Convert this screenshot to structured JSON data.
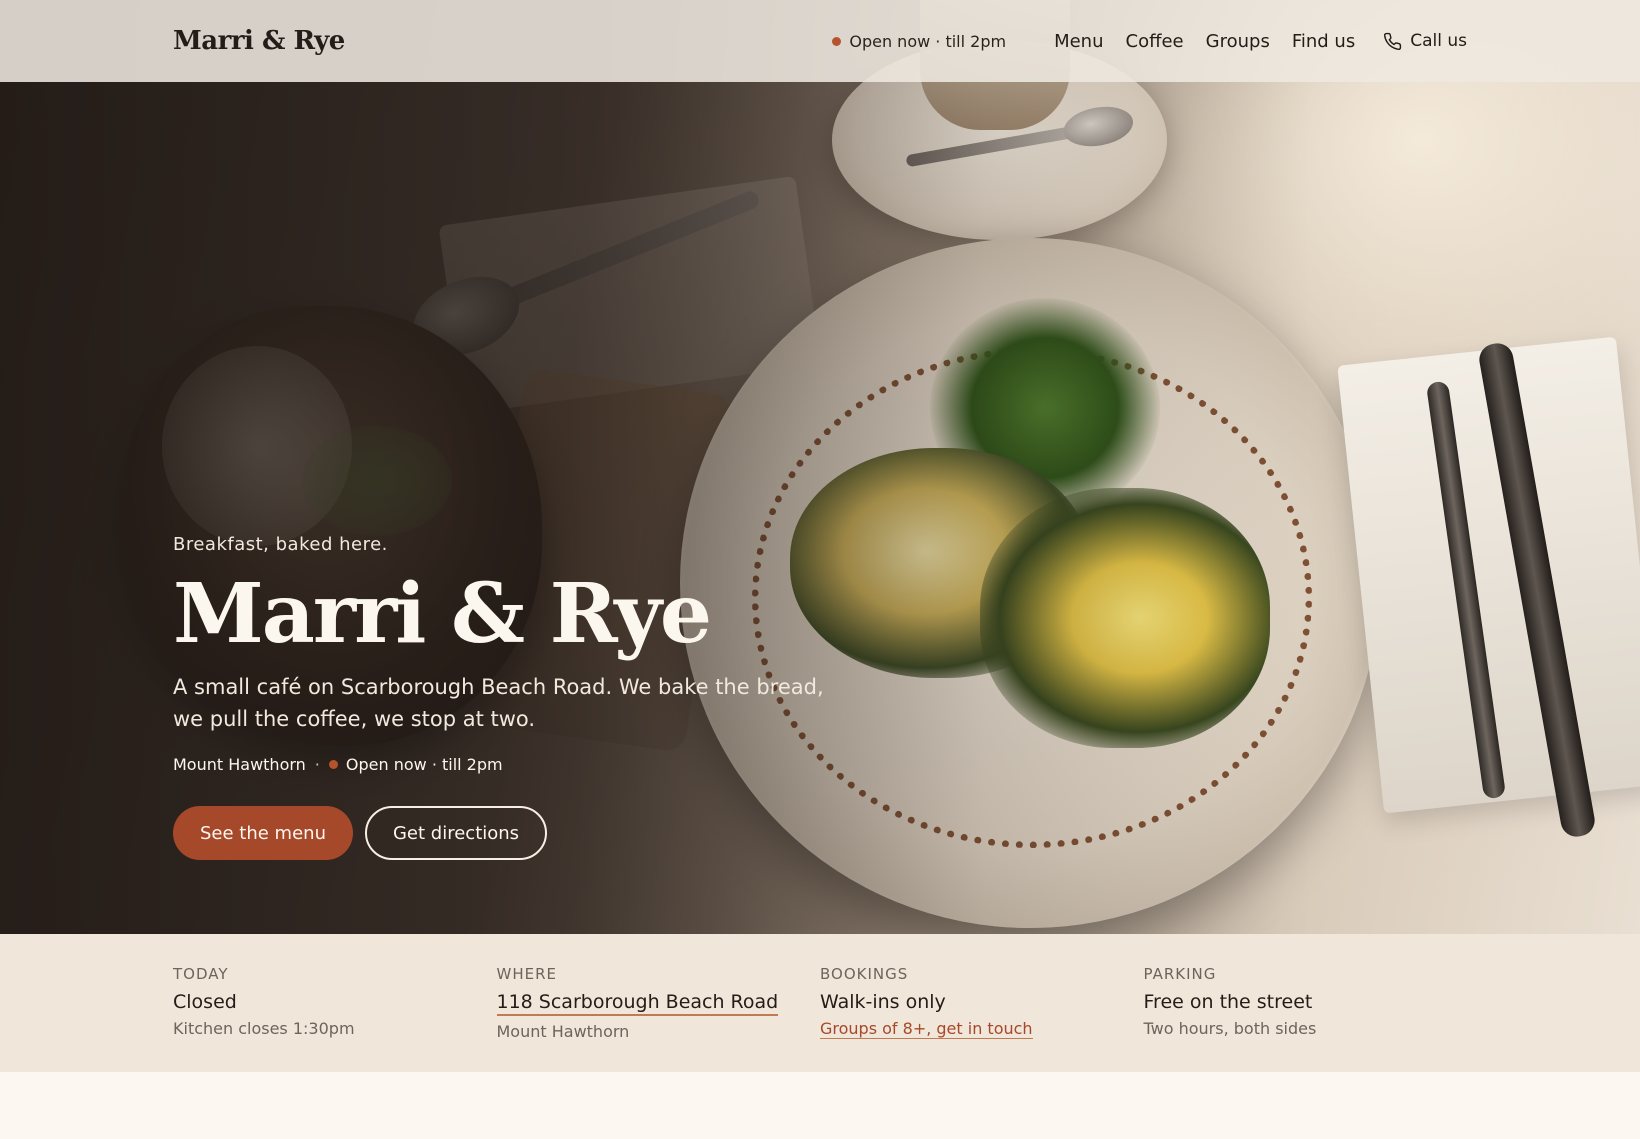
{
  "header": {
    "logo": "Marri & Rye",
    "status": "Open now · till 2pm",
    "nav": [
      "Menu",
      "Coffee",
      "Groups",
      "Find us"
    ],
    "call": "Call us"
  },
  "hero": {
    "eyebrow": "Breakfast, baked here.",
    "title": "Marri & Rye",
    "description": "A small café on Scarborough Beach Road. We bake the bread, we pull the coffee, we stop at two.",
    "location": "Mount Hawthorn",
    "separator": "·",
    "status": "Open now · till 2pm",
    "primary_cta": "See the menu",
    "secondary_cta": "Get directions"
  },
  "info": [
    {
      "label": "TODAY",
      "value": "Closed",
      "sub": "Kitchen closes 1:30pm"
    },
    {
      "label": "WHERE",
      "value": "118 Scarborough Beach Road",
      "sub": "Mount Hawthorn"
    },
    {
      "label": "BOOKINGS",
      "value": "Walk-ins only",
      "sub": "Groups of 8+, get in touch"
    },
    {
      "label": "PARKING",
      "value": "Free on the street",
      "sub": "Two hours, both sides"
    }
  ],
  "colors": {
    "accent": "#a6492a",
    "status_dot": "#b4532e",
    "strip_bg": "#f0e6d9"
  },
  "icons": {
    "call": "phone-icon",
    "status": "status-dot"
  }
}
